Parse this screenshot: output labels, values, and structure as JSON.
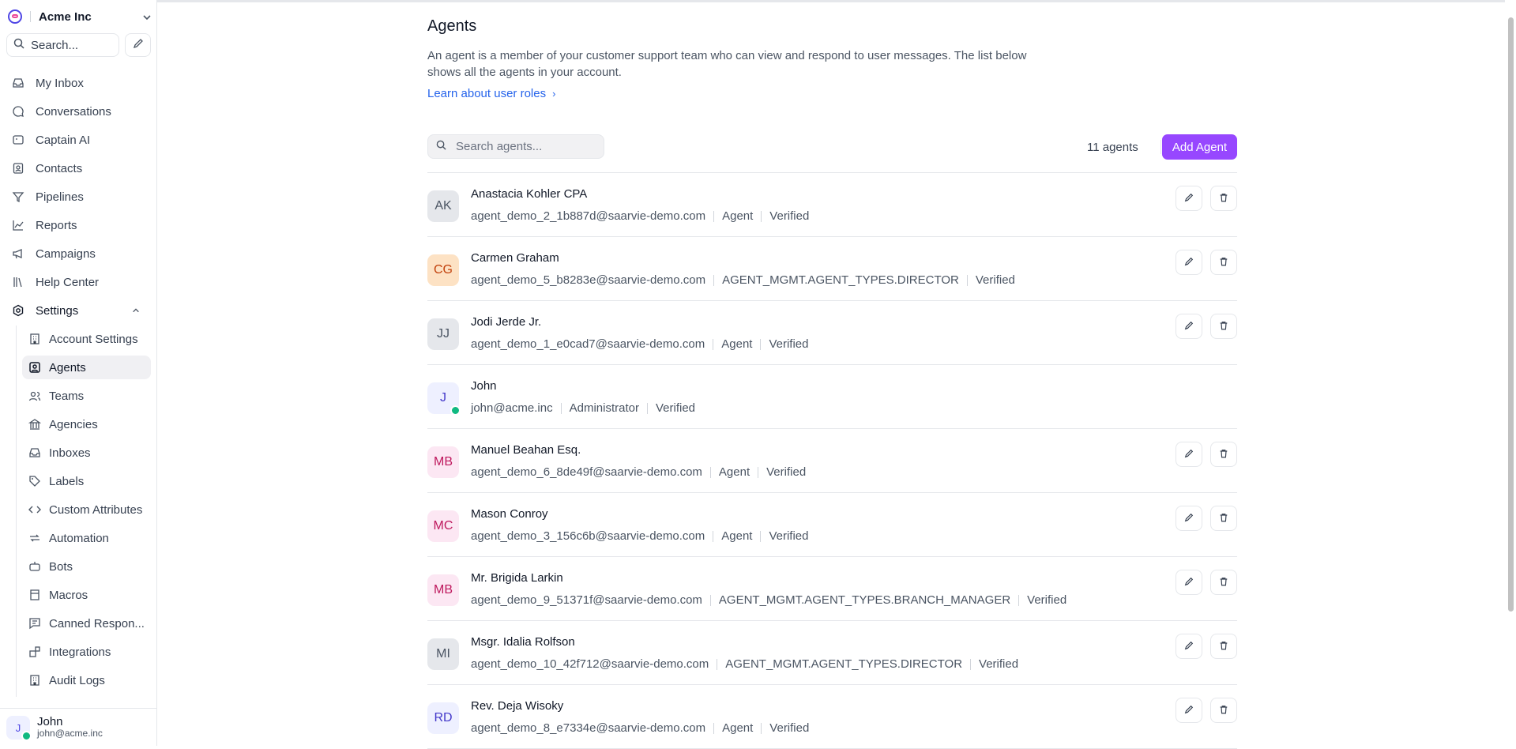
{
  "account": {
    "name": "Acme Inc"
  },
  "sidebar": {
    "search_label": "Search...",
    "nav": [
      {
        "label": "My Inbox",
        "icon": "inbox-icon"
      },
      {
        "label": "Conversations",
        "icon": "chat-bubble-icon"
      },
      {
        "label": "Captain AI",
        "icon": "bot-icon"
      },
      {
        "label": "Contacts",
        "icon": "contact-card-icon"
      },
      {
        "label": "Pipelines",
        "icon": "funnel-icon"
      },
      {
        "label": "Reports",
        "icon": "line-chart-icon"
      },
      {
        "label": "Campaigns",
        "icon": "megaphone-icon"
      },
      {
        "label": "Help Center",
        "icon": "library-icon"
      },
      {
        "label": "Settings",
        "icon": "settings-icon"
      }
    ],
    "settings_items": [
      {
        "label": "Account Settings",
        "icon": "building-icon"
      },
      {
        "label": "Agents",
        "icon": "user-square-icon"
      },
      {
        "label": "Teams",
        "icon": "users-icon"
      },
      {
        "label": "Agencies",
        "icon": "bank-icon"
      },
      {
        "label": "Inboxes",
        "icon": "inbox-icon"
      },
      {
        "label": "Labels",
        "icon": "tag-icon"
      },
      {
        "label": "Custom Attributes",
        "icon": "code-icon"
      },
      {
        "label": "Automation",
        "icon": "arrows-repeat-icon"
      },
      {
        "label": "Bots",
        "icon": "robot-icon"
      },
      {
        "label": "Macros",
        "icon": "macro-icon"
      },
      {
        "label": "Canned Respon...",
        "icon": "message-text-icon"
      },
      {
        "label": "Integrations",
        "icon": "blocks-icon"
      },
      {
        "label": "Audit Logs",
        "icon": "building-icon"
      }
    ],
    "user": {
      "initial": "J",
      "name": "John",
      "email": "john@acme.inc"
    }
  },
  "page": {
    "title": "Agents",
    "description": "An agent is a member of your customer support team who can view and respond to user messages. The list below shows all the agents in your account.",
    "learn_link": "Learn about user roles",
    "search_placeholder": "Search agents...",
    "count": "11 agents",
    "add_button": "Add Agent"
  },
  "colors": {
    "accent": "#9747ff",
    "link": "#2563eb",
    "online": "#10b981"
  },
  "agents": [
    {
      "initials": "AK",
      "name": "Anastacia Kohler CPA",
      "email": "agent_demo_2_1b887d@saarvie-demo.com",
      "role": "Agent",
      "status": "Verified",
      "avatar_bg": "#e5e7eb",
      "avatar_fg": "#4b5563",
      "actions": true
    },
    {
      "initials": "CG",
      "name": "Carmen Graham",
      "email": "agent_demo_5_b8283e@saarvie-demo.com",
      "role": "AGENT_MGMT.AGENT_TYPES.DIRECTOR",
      "status": "Verified",
      "avatar_bg": "#fde2c4",
      "avatar_fg": "#c2410c",
      "actions": true
    },
    {
      "initials": "JJ",
      "name": "Jodi Jerde Jr.",
      "email": "agent_demo_1_e0cad7@saarvie-demo.com",
      "role": "Agent",
      "status": "Verified",
      "avatar_bg": "#e5e7eb",
      "avatar_fg": "#4b5563",
      "actions": true
    },
    {
      "initials": "J",
      "name": "John",
      "email": "john@acme.inc",
      "role": "Administrator",
      "status": "Verified",
      "avatar_bg": "#eef0ff",
      "avatar_fg": "#4338ca",
      "actions": false,
      "online": true
    },
    {
      "initials": "MB",
      "name": "Manuel Beahan Esq.",
      "email": "agent_demo_6_8de49f@saarvie-demo.com",
      "role": "Agent",
      "status": "Verified",
      "avatar_bg": "#fce7f3",
      "avatar_fg": "#be185d",
      "actions": true
    },
    {
      "initials": "MC",
      "name": "Mason Conroy",
      "email": "agent_demo_3_156c6b@saarvie-demo.com",
      "role": "Agent",
      "status": "Verified",
      "avatar_bg": "#fce7f3",
      "avatar_fg": "#be185d",
      "actions": true
    },
    {
      "initials": "MB",
      "name": "Mr. Brigida Larkin",
      "email": "agent_demo_9_51371f@saarvie-demo.com",
      "role": "AGENT_MGMT.AGENT_TYPES.BRANCH_MANAGER",
      "status": "Verified",
      "avatar_bg": "#fce7f3",
      "avatar_fg": "#be185d",
      "actions": true
    },
    {
      "initials": "MI",
      "name": "Msgr. Idalia Rolfson",
      "email": "agent_demo_10_42f712@saarvie-demo.com",
      "role": "AGENT_MGMT.AGENT_TYPES.DIRECTOR",
      "status": "Verified",
      "avatar_bg": "#e5e7eb",
      "avatar_fg": "#4b5563",
      "actions": true
    },
    {
      "initials": "RD",
      "name": "Rev. Deja Wisoky",
      "email": "agent_demo_8_e7334e@saarvie-demo.com",
      "role": "Agent",
      "status": "Verified",
      "avatar_bg": "#eef0ff",
      "avatar_fg": "#4338ca",
      "actions": true
    }
  ]
}
